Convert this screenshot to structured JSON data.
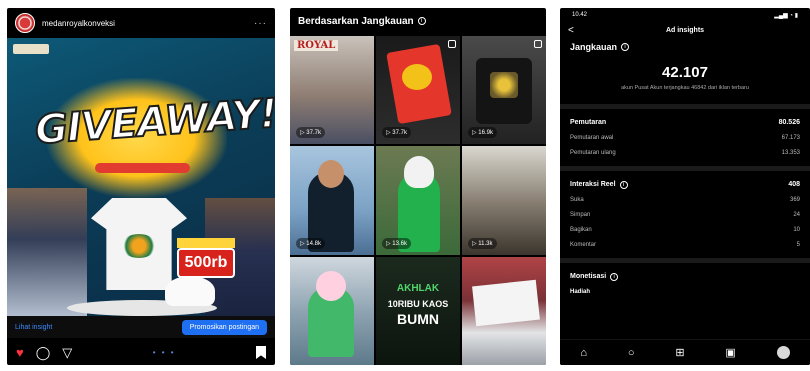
{
  "post": {
    "username": "medanroyalkonveksi",
    "menu": "···",
    "headline": "GIVEAWAY!",
    "price": "500rb",
    "view_insight": "Lihat insight",
    "promote_button": "Promosikan postingan",
    "carousel_dots": "• • •"
  },
  "reach_grid": {
    "title": "Berdasarkan Jangkauan",
    "info_symbol": "i",
    "royal_label": "ROYAL",
    "tiles": [
      {
        "plays": "▷ 37.7k"
      },
      {
        "plays": "▷ 37.7k"
      },
      {
        "plays": "▷ 16.9k"
      },
      {
        "plays": "▷ 14.8k"
      },
      {
        "plays": "▷ 13.6k"
      },
      {
        "plays": "▷ 11.3k"
      },
      {
        "plays": ""
      },
      {
        "plays": ""
      },
      {
        "plays": ""
      }
    ],
    "tile8_text": {
      "line1": "AKHLAK",
      "line2": "10RIBU KAOS",
      "line3": "BUMN"
    }
  },
  "insights": {
    "time": "10.42",
    "status_icons": "▂▄▆ ◔ ▮",
    "nav_title": "Ad insights",
    "back_symbol": "<",
    "reach_title": "Jangkauan",
    "reach_value": "42.107",
    "reach_caption": "akun Pusat Akun terjangkau 46842 dari iklan terbaru",
    "plays": {
      "label": "Pemutaran",
      "value": "80.526",
      "rows": [
        {
          "label": "Pemutaran awal",
          "value": "67.173"
        },
        {
          "label": "Pemutaran ulang",
          "value": "13.353"
        }
      ]
    },
    "reel_interactions": {
      "label": "Interaksi Reel",
      "value": "408",
      "rows": [
        {
          "label": "Suka",
          "value": "369"
        },
        {
          "label": "Simpan",
          "value": "24"
        },
        {
          "label": "Bagikan",
          "value": "10"
        },
        {
          "label": "Komentar",
          "value": "5"
        }
      ]
    },
    "monetization": {
      "label": "Monetisasi",
      "gift_label": "Hadiah"
    }
  }
}
